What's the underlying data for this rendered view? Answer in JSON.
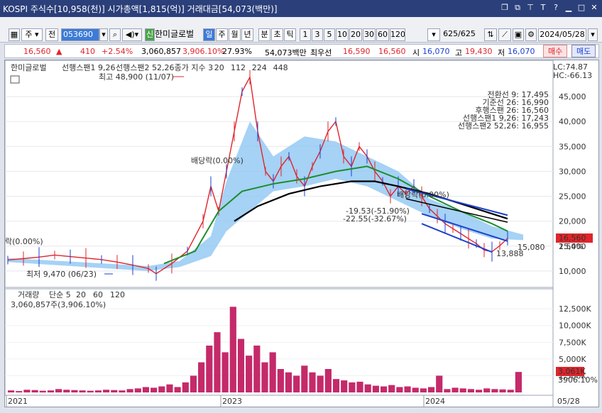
{
  "titlebar": {
    "text": "KOSPI 주식수[10,958(천)] 시가총액[1,815(억)] 거래대금[54,073(백만)]"
  },
  "toolbar": {
    "code": "053690",
    "name": "한미글로벌",
    "type_label": "주",
    "prev_label": "전",
    "sin_label": "신",
    "periods": [
      "일",
      "주",
      "월",
      "년",
      "분",
      "초",
      "틱"
    ],
    "active_period": "일",
    "intervals": [
      "1",
      "3",
      "5",
      "10",
      "20",
      "30",
      "60",
      "120"
    ],
    "page_count": "625/625",
    "date": "2024/05/28"
  },
  "quote": {
    "price": "16,560",
    "change": "410",
    "change_pct": "+2.54%",
    "volume": "3,060,857",
    "vol_ratio": "3,906.10%",
    "turnover_pct": "27.93%",
    "amount": "54,073백만",
    "best_label": "최우선",
    "ask": "16,590",
    "bid": "16,560",
    "open_label": "시",
    "open": "16,070",
    "high_label": "고",
    "high": "19,430",
    "low_label": "저",
    "low": "16,070",
    "buy_label": "매수",
    "sell_label": "매도"
  },
  "colors": {
    "up": "#e0242b",
    "down": "#1c3fcf",
    "cloud": "#8fc7f2",
    "ma112": "#1e8c2a",
    "ma224": "#000000",
    "ma20": "#3c3cd8",
    "volume": "#c42a6a"
  },
  "chart_data": [
    {
      "type": "candlestick",
      "title": "한미글로벌",
      "legend": [
        "선행스팬1 9,26",
        "선행스팬2 52,26",
        "종가 지수 3",
        "20",
        "112",
        "224",
        "448"
      ],
      "x_ticks": [
        "2021",
        "2023",
        "2024",
        "05/28"
      ],
      "y_ticks": [
        10000,
        15000,
        20000,
        25000,
        30000,
        35000,
        40000,
        45000
      ],
      "y_tick_labels": [
        "10,000",
        "15,000",
        "20,000",
        "25,000",
        "30,000",
        "35,000",
        "40,000",
        "45,000"
      ],
      "ylim": [
        7000,
        50000
      ],
      "close_series": [
        {
          "t": 0,
          "v": 12200
        },
        {
          "t": 2,
          "v": 12500
        },
        {
          "t": 4,
          "v": 12800
        },
        {
          "t": 6,
          "v": 13200
        },
        {
          "t": 8,
          "v": 12900
        },
        {
          "t": 10,
          "v": 12600
        },
        {
          "t": 12,
          "v": 12300
        },
        {
          "t": 14,
          "v": 11800
        },
        {
          "t": 16,
          "v": 11200
        },
        {
          "t": 18,
          "v": 10500
        },
        {
          "t": 19,
          "v": 9470
        },
        {
          "t": 21,
          "v": 11500
        },
        {
          "t": 23,
          "v": 14000
        },
        {
          "t": 25,
          "v": 20000
        },
        {
          "t": 26,
          "v": 27000
        },
        {
          "t": 27,
          "v": 22000
        },
        {
          "t": 28,
          "v": 30000
        },
        {
          "t": 29,
          "v": 38000
        },
        {
          "t": 30,
          "v": 46000
        },
        {
          "t": 31,
          "v": 48900
        },
        {
          "t": 32,
          "v": 38000
        },
        {
          "t": 33,
          "v": 30000
        },
        {
          "t": 34,
          "v": 28000
        },
        {
          "t": 35,
          "v": 31000
        },
        {
          "t": 36,
          "v": 33000
        },
        {
          "t": 37,
          "v": 29000
        },
        {
          "t": 38,
          "v": 27000
        },
        {
          "t": 39,
          "v": 31000
        },
        {
          "t": 40,
          "v": 34000
        },
        {
          "t": 41,
          "v": 38000
        },
        {
          "t": 42,
          "v": 40000
        },
        {
          "t": 43,
          "v": 33000
        },
        {
          "t": 44,
          "v": 31000
        },
        {
          "t": 45,
          "v": 35000
        },
        {
          "t": 46,
          "v": 33000
        },
        {
          "t": 47,
          "v": 30000
        },
        {
          "t": 48,
          "v": 28000
        },
        {
          "t": 49,
          "v": 25000
        },
        {
          "t": 50,
          "v": 27000
        },
        {
          "t": 51,
          "v": 25500
        },
        {
          "t": 52,
          "v": 27000
        },
        {
          "t": 53,
          "v": 25000
        },
        {
          "t": 54,
          "v": 22500
        },
        {
          "t": 55,
          "v": 21000
        },
        {
          "t": 56,
          "v": 19500
        },
        {
          "t": 57,
          "v": 18500
        },
        {
          "t": 58,
          "v": 17500
        },
        {
          "t": 59,
          "v": 16500
        },
        {
          "t": 60,
          "v": 15500
        },
        {
          "t": 61,
          "v": 14200
        },
        {
          "t": 62,
          "v": 13888
        },
        {
          "t": 63,
          "v": 15080
        },
        {
          "t": 64,
          "v": 16560
        }
      ],
      "cloud_upper": [
        {
          "t": 0,
          "v": 12600
        },
        {
          "t": 18,
          "v": 11000
        },
        {
          "t": 22,
          "v": 12000
        },
        {
          "t": 26,
          "v": 17000
        },
        {
          "t": 28,
          "v": 28000
        },
        {
          "t": 31,
          "v": 40000
        },
        {
          "t": 34,
          "v": 33000
        },
        {
          "t": 38,
          "v": 37000
        },
        {
          "t": 42,
          "v": 36000
        },
        {
          "t": 46,
          "v": 33000
        },
        {
          "t": 50,
          "v": 30000
        },
        {
          "t": 54,
          "v": 24500
        },
        {
          "t": 58,
          "v": 22000
        },
        {
          "t": 62,
          "v": 19000
        },
        {
          "t": 66,
          "v": 17300
        }
      ],
      "cloud_lower": [
        {
          "t": 0,
          "v": 11800
        },
        {
          "t": 18,
          "v": 10000
        },
        {
          "t": 22,
          "v": 10800
        },
        {
          "t": 26,
          "v": 13000
        },
        {
          "t": 28,
          "v": 18000
        },
        {
          "t": 31,
          "v": 22000
        },
        {
          "t": 34,
          "v": 26000
        },
        {
          "t": 38,
          "v": 27000
        },
        {
          "t": 42,
          "v": 28500
        },
        {
          "t": 46,
          "v": 27000
        },
        {
          "t": 50,
          "v": 24000
        },
        {
          "t": 54,
          "v": 21000
        },
        {
          "t": 58,
          "v": 18500
        },
        {
          "t": 62,
          "v": 16500
        },
        {
          "t": 66,
          "v": 16200
        }
      ],
      "ma112": [
        {
          "t": 20,
          "v": 11500
        },
        {
          "t": 24,
          "v": 14000
        },
        {
          "t": 27,
          "v": 22000
        },
        {
          "t": 30,
          "v": 26000
        },
        {
          "t": 34,
          "v": 27500
        },
        {
          "t": 38,
          "v": 28500
        },
        {
          "t": 42,
          "v": 30000
        },
        {
          "t": 46,
          "v": 31000
        },
        {
          "t": 50,
          "v": 28500
        },
        {
          "t": 54,
          "v": 25000
        },
        {
          "t": 58,
          "v": 22000
        },
        {
          "t": 62,
          "v": 19500
        },
        {
          "t": 64,
          "v": 18000
        }
      ],
      "ma224": [
        {
          "t": 29,
          "v": 20000
        },
        {
          "t": 32,
          "v": 23000
        },
        {
          "t": 36,
          "v": 25500
        },
        {
          "t": 40,
          "v": 27000
        },
        {
          "t": 44,
          "v": 28000
        },
        {
          "t": 47,
          "v": 28000
        },
        {
          "t": 50,
          "v": 27000
        },
        {
          "t": 54,
          "v": 25500
        },
        {
          "t": 58,
          "v": 23500
        },
        {
          "t": 62,
          "v": 21500
        },
        {
          "t": 64,
          "v": 20500
        }
      ],
      "annotations": [
        {
          "text": "최고 48,900 (11/07)"
        },
        {
          "text": "최저 9,470 (06/23)"
        },
        {
          "text": "배당락(0.00%)"
        },
        {
          "text": "배당락(0.00%)"
        },
        {
          "text": "락(0.00%)"
        },
        {
          "text": "-19.53(-51.90%)"
        },
        {
          "text": "-22.55(-32.67%)"
        },
        {
          "text": "15,080"
        },
        {
          "text": "13,888"
        }
      ],
      "ichimoku_values": [
        "전환선 9: 17,495",
        "기준선 26: 16,990",
        "후행스팬 26: 16,560",
        "선행스팬1 9,26: 17,243",
        "선행스팬2 52,26: 16,955"
      ],
      "lc": "LC:74.87",
      "hc": "HC:-66.13",
      "price_badge": "16,560",
      "pct_badge": "2.54%"
    },
    {
      "type": "bar",
      "title": "거래량",
      "legend": [
        "단순 5",
        "20",
        "60",
        "120"
      ],
      "header_value": "3,060,857주(3,906.10%)",
      "y_ticks": [
        2500,
        5000,
        7500,
        10000,
        12500
      ],
      "y_tick_labels": [
        "2,500K",
        "5,000K",
        "7,500K",
        "10,000K",
        "12,500K"
      ],
      "ylim": [
        0,
        14000
      ],
      "unit": "K",
      "series": [
        {
          "name": "거래량",
          "values": [
            300,
            200,
            400,
            350,
            250,
            300,
            500,
            400,
            350,
            300,
            250,
            300,
            400,
            350,
            300,
            500,
            600,
            800,
            700,
            900,
            1200,
            800,
            1500,
            2500,
            4500,
            7000,
            9000,
            6000,
            12800,
            8000,
            5500,
            7000,
            4500,
            6000,
            3500,
            3000,
            2500,
            4000,
            3000,
            2500,
            3500,
            2000,
            1800,
            1500,
            1600,
            1200,
            1000,
            900,
            1100,
            800,
            900,
            700,
            600,
            800,
            2500,
            500,
            700,
            600,
            500,
            400,
            600,
            500,
            450,
            400,
            3061
          ]
        }
      ],
      "volume_badge": "3,061K",
      "pct_badge": "3906.10%"
    }
  ]
}
